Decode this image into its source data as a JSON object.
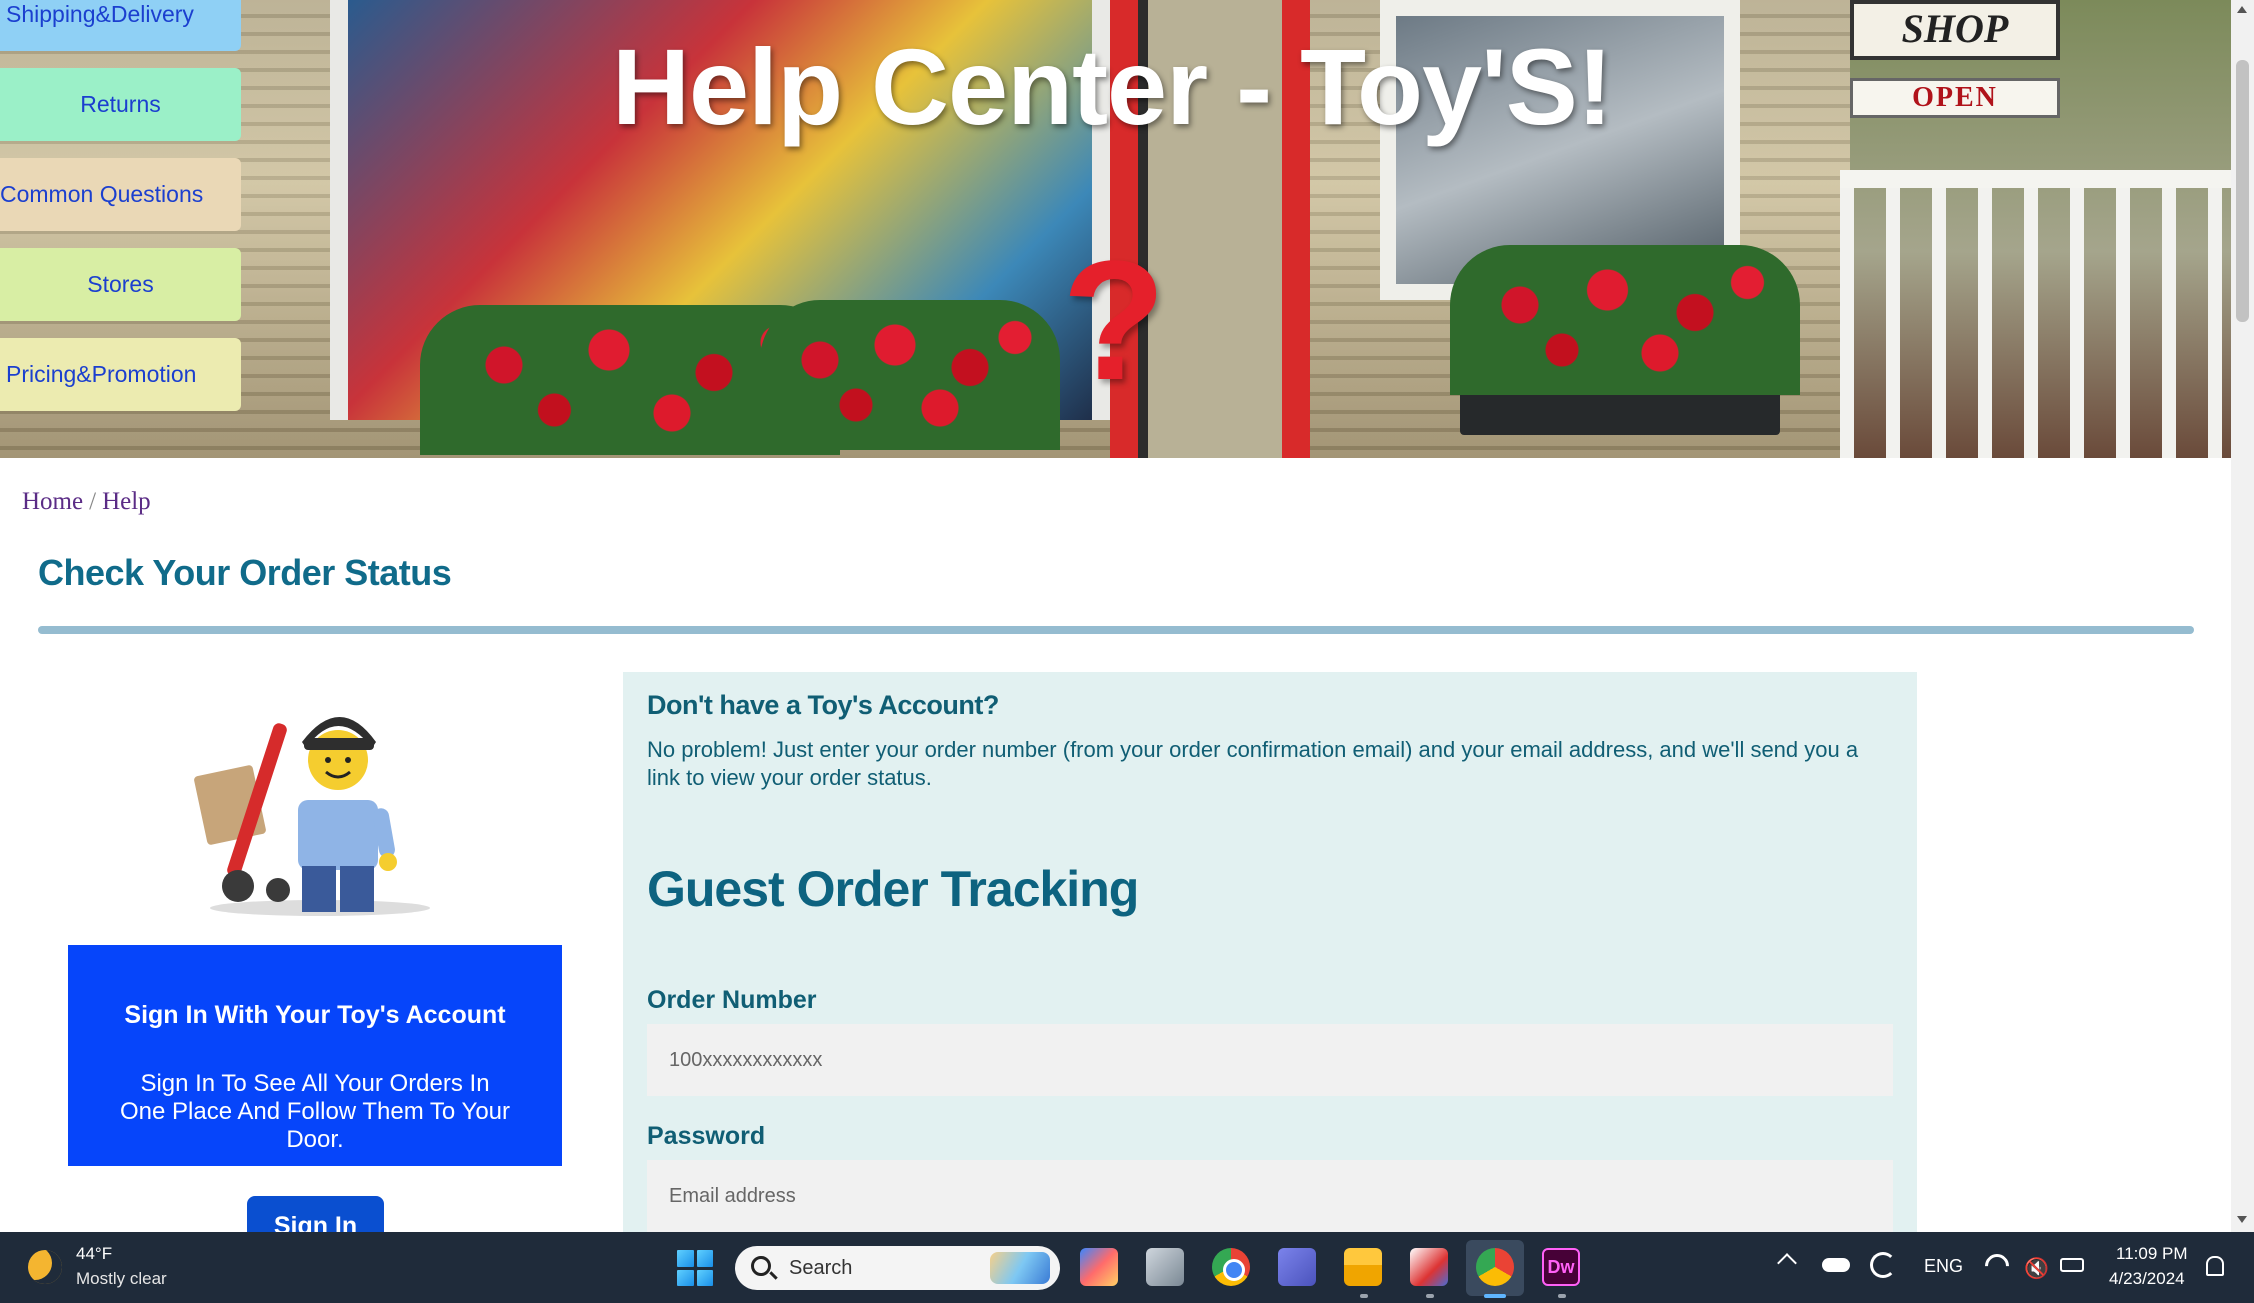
{
  "hero": {
    "title": "Help Center - Toy'S!",
    "shop_sign": "SHOP",
    "open_sign": "OPEN",
    "question_mark": "?"
  },
  "nav": {
    "items": [
      {
        "label": "Shipping&Delivery",
        "color": "#8fd0f5"
      },
      {
        "label": "Returns",
        "color": "#9bf0c8"
      },
      {
        "label": "Common Questions",
        "color": "#ead8b6"
      },
      {
        "label": "Stores",
        "color": "#d8eea4"
      },
      {
        "label": "Pricing&Promotion",
        "color": "#ecebb0"
      }
    ]
  },
  "breadcrumb": {
    "home": "Home",
    "separator": "/",
    "current": "Help"
  },
  "section": {
    "title": "Check Your Order Status"
  },
  "signin": {
    "heading": "Sign In With Your Toy's Account",
    "body": "Sign In To See All Your Orders In One Place And Follow Them To Your Door.",
    "button": "Sign In"
  },
  "guest": {
    "question": "Don't have a Toy's Account?",
    "description": "No problem! Just enter your order number (from your order confirmation email) and your email address, and we'll send you a link to view your order status.",
    "title": "Guest Order Tracking",
    "order_label": "Order Number",
    "order_placeholder": "100xxxxxxxxxxxx",
    "password_label": "Password",
    "password_placeholder": "Email address"
  },
  "taskbar": {
    "weather_temp": "44°F",
    "weather_desc": "Mostly clear",
    "search_label": "Search",
    "apps": [
      "copilot-icon",
      "task-view-icon",
      "chrome-icon",
      "teams-icon",
      "file-explorer-icon",
      "snipping-tool-icon",
      "chrome-profile-icon",
      "dreamweaver-icon"
    ],
    "dreamweaver_label": "Dw",
    "language": "ENG",
    "time": "11:09 PM",
    "date": "4/23/2024"
  },
  "colors": {
    "accent_teal": "#106b8a",
    "signin_blue": "#0645fa",
    "guest_panel": "#e2f1f1",
    "breadcrumb_purple": "#5b2c86"
  }
}
